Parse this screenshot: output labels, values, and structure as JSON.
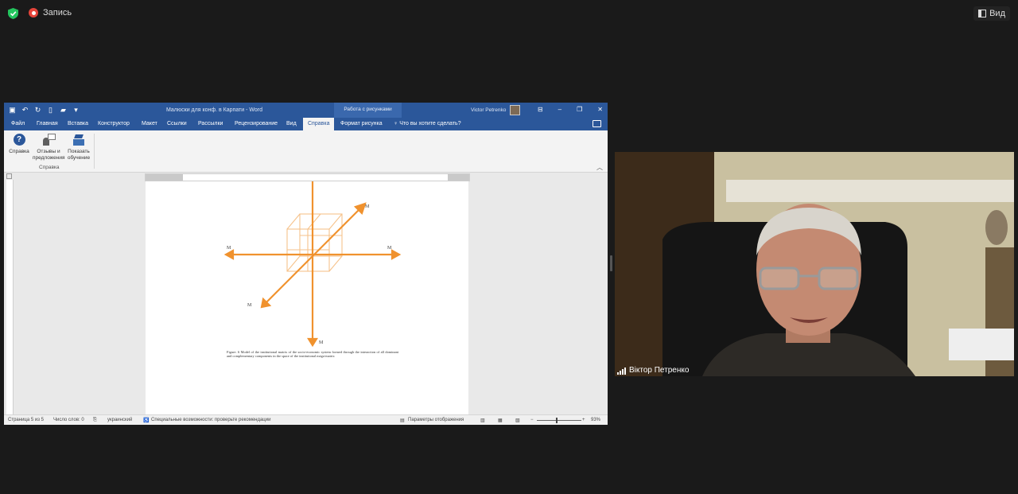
{
  "topbar": {
    "recording_label": "Запись",
    "view_label": "Вид"
  },
  "word": {
    "doc_title": "Малюски для конф. в Карпати  -  Word",
    "context_group": "Работа с рисунками",
    "user_name": "Victor Petrenko",
    "tabs": [
      "Файл",
      "Главная",
      "Вставка",
      "Конструктор",
      "Макет",
      "Ссылки",
      "Рассылки",
      "Рецензирование",
      "Вид",
      "Справка",
      "Формат рисунка"
    ],
    "active_tab": "Справка",
    "tell_me": "Что вы хотите сделать?",
    "ribbon": {
      "help_label": "Справка",
      "feedback_label_1": "Отзывы и",
      "feedback_label_2": "предложения",
      "training_label_1": "Показать",
      "training_label_2": "обучение",
      "group_label": "Справка"
    },
    "caption": "Figure. 6 Model of the institutional matrix of the socio-economic system formed through the interaction of all dominant and complementary components in the space of the institutional mega-matrix",
    "figure_labels": {
      "top_right": "M",
      "left": "M",
      "right": "M",
      "bottom_left": "M",
      "bottom": "M"
    },
    "status": {
      "page": "Страница 5 из 5",
      "words": "Число слов: 0",
      "language": "украинский",
      "accessibility": "Специальные возможности: проверьте рекомендации",
      "display_settings": "Параметры отображения",
      "zoom": "93%"
    }
  },
  "video": {
    "participant_name": "Віктор Петренко"
  },
  "colors": {
    "word_blue": "#2b579a",
    "arrow_orange": "#f0922e",
    "record_red": "#e5443a"
  }
}
